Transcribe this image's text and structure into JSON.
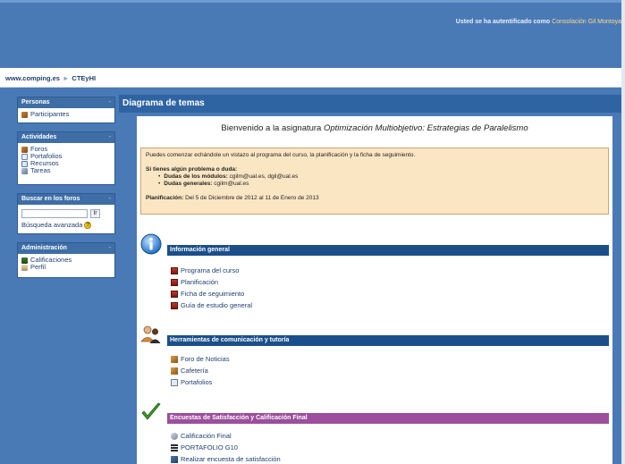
{
  "header": {
    "login_prefix": "Usted se ha autentificado como",
    "login_name": "Consolación Gil Montoya"
  },
  "breadcrumb": {
    "site": "www.comping.es",
    "separator": "►",
    "course": "CTEyHI"
  },
  "sidebar": {
    "people": {
      "title": "Personas",
      "items": [
        {
          "label": "Participantes",
          "icon": "participants-icon"
        }
      ]
    },
    "activities": {
      "title": "Actividades",
      "items": [
        {
          "label": "Foros",
          "icon": "forum-icon"
        },
        {
          "label": "Portafolios",
          "icon": "portfolio-icon"
        },
        {
          "label": "Recursos",
          "icon": "resource-icon"
        },
        {
          "label": "Tareas",
          "icon": "task-icon"
        }
      ]
    },
    "forum_search": {
      "title": "Buscar en los foros",
      "go_label": "Ir",
      "advanced_label": "Búsqueda avanzada",
      "help_symbol": "?"
    },
    "administration": {
      "title": "Administración",
      "items": [
        {
          "label": "Calificaciones",
          "icon": "grades-icon"
        },
        {
          "label": "Perfil",
          "icon": "profile-icon"
        }
      ]
    },
    "toggle_symbol": "-"
  },
  "main": {
    "title": "Diagrama de temas",
    "welcome_prefix": "Bienvenido a la asignatura",
    "course_name": "Optimización Multiobjetivo: Estrategias de Paralelismo",
    "info": {
      "intro": "Puedes comenzar echándole un vistazo al programa del curso, la planificación y la ficha de seguimiento.",
      "question": "Si tienes algún problema o duda:",
      "doubts_modules_label": "Dudas de los módulos:",
      "doubts_modules_value": "cgilm@ual.es, dgil@ual.es",
      "doubts_general_label": "Dudas generales:",
      "doubts_general_value": "cgilm@ual.es",
      "planning_label": "Planificación:",
      "planning_value": "Del 5 de Diciembre de 2012 al 11 de Enero de 2013"
    },
    "sections": [
      {
        "title": "Información general",
        "icon": "info-icon",
        "items": [
          {
            "label": "Programa del curso",
            "icon": "pdf-icon"
          },
          {
            "label": "Planificación",
            "icon": "pdf-icon"
          },
          {
            "label": "Ficha de seguimiento",
            "icon": "pdf-icon"
          },
          {
            "label": "Guía de estudio general",
            "icon": "pdf-icon"
          }
        ]
      },
      {
        "title": "Herramientas de comunicación y tutoría",
        "icon": "people-icon",
        "items": [
          {
            "label": "Foro de Noticias",
            "icon": "forum-icon"
          },
          {
            "label": "Cafetería",
            "icon": "forum-icon"
          },
          {
            "label": "Portafolios",
            "icon": "portfolio-icon"
          }
        ]
      },
      {
        "title": "Encuestas de Satisfacción y Calificación Final",
        "icon": "checkmark-icon",
        "items": [
          {
            "label": "Calificación Final",
            "icon": "grade-icon"
          },
          {
            "label": "PORTAFOLIO G10",
            "icon": "bars-icon"
          },
          {
            "label": "Realizar encuesta de satisfacción",
            "icon": "survey-icon"
          }
        ]
      }
    ]
  },
  "colors": {
    "page_blue": "#4a7ab6",
    "section_bar_blue": "#1b4f8a",
    "section_bar_purple": "#9b4f9c",
    "info_box": "#fbe6c4"
  }
}
